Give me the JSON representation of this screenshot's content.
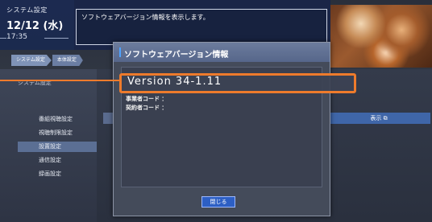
{
  "header": {
    "system_label": "システム設定",
    "date": "12/12 (水)",
    "time": "17:35",
    "message": "ソフトウェアバージョン情報を表示します。"
  },
  "breadcrumb": [
    "システム設定",
    "本体設定"
  ],
  "menu": {
    "header": "システム設定",
    "items": [
      "番組視聴設定",
      "視聴制限設定",
      "設置設定",
      "通信設定",
      "録画設定"
    ],
    "selected_index": 2
  },
  "right_panel": {
    "display_button": "表示 ⧉"
  },
  "dialog": {
    "title": "ソフトウェアバージョン情報",
    "version": "Version 34-1.11",
    "lines": [
      "事業者コード   ：",
      "契約者コード   ："
    ],
    "close_button": "閉じる"
  },
  "colors": {
    "highlight": "#ee7b2c",
    "accent_blue": "#2d5fc4"
  },
  "icons": {
    "external": "external-link-icon"
  }
}
